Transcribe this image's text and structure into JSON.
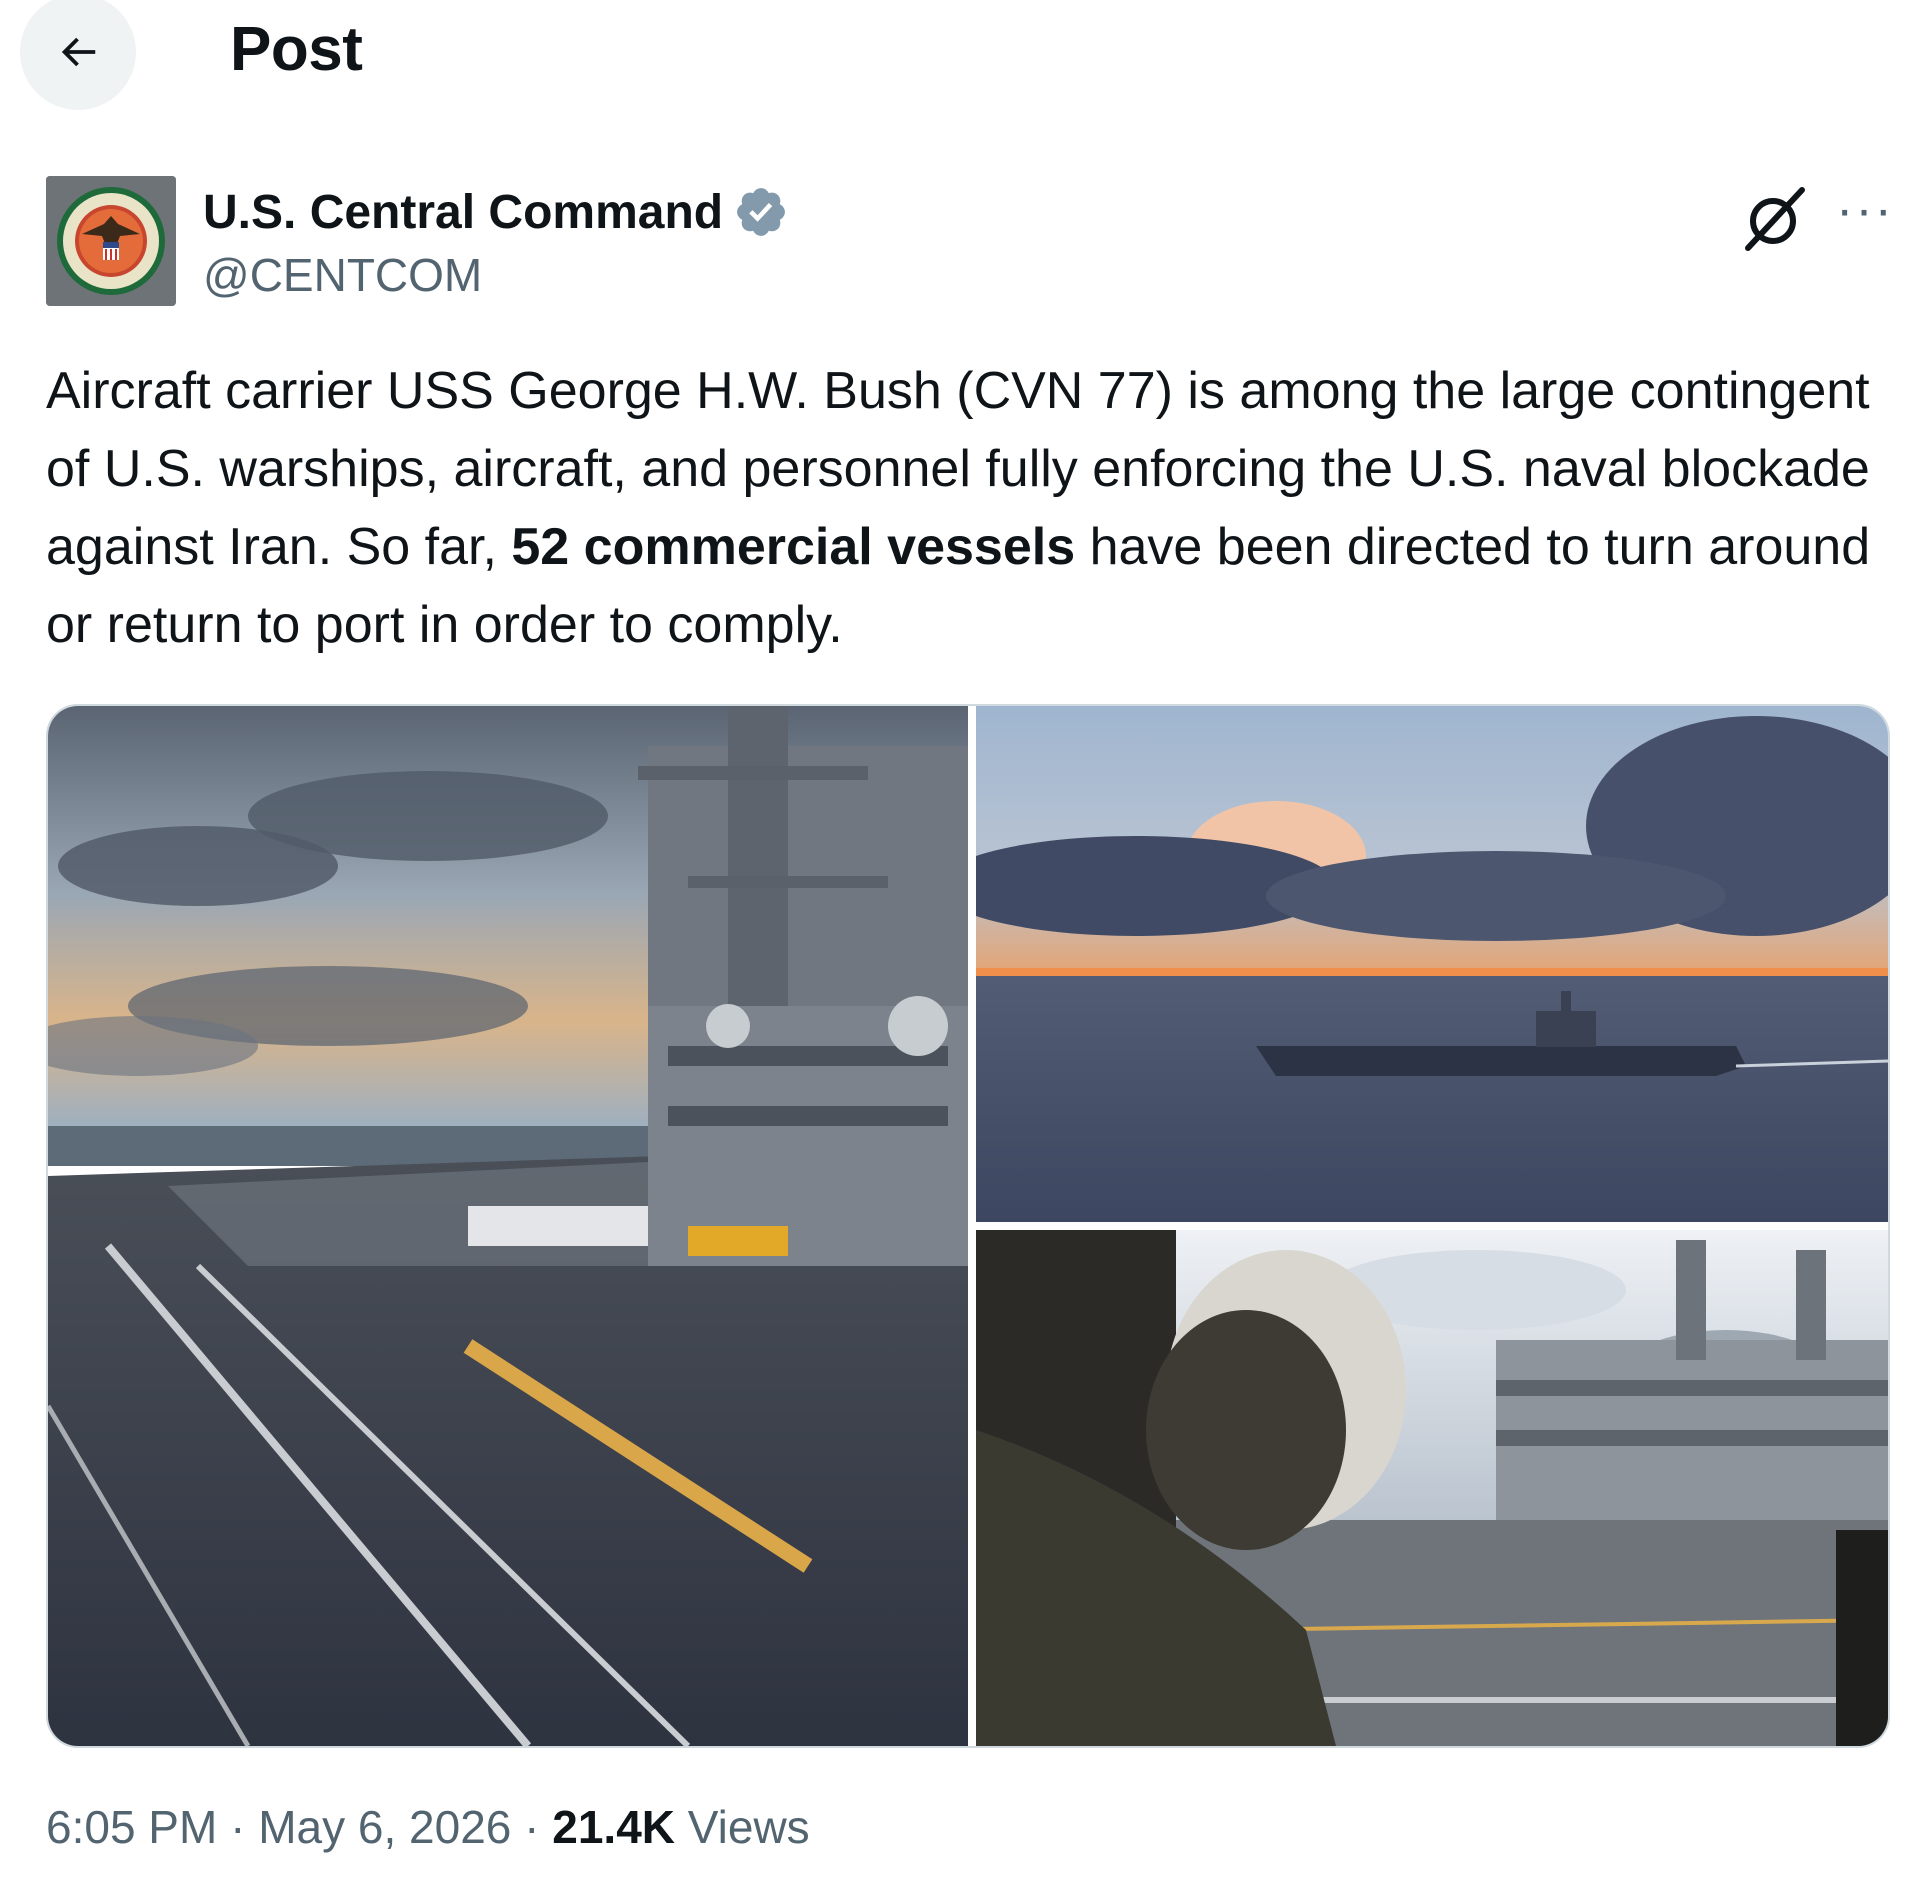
{
  "header": {
    "title": "Post",
    "back_icon": "arrow-left-icon"
  },
  "author": {
    "name": "U.S. Central Command",
    "handle": "@CENTCOM",
    "verified": true,
    "verified_color": "#829aab"
  },
  "actions": {
    "grok_icon": "grok-icon",
    "more_icon": "more-horizontal-icon",
    "more_label": "···"
  },
  "tweet": {
    "text_before": "Aircraft carrier USS George H.W. Bush (CVN 77) is among the large contingent of U.S. warships, aircraft, and personnel fully enforcing the U.S. naval blockade against Iran. So far, ",
    "text_bold": "52 commercial vessels",
    "text_after": " have been directed to turn around or return to port in order to comply."
  },
  "media": {
    "photo_count": 3
  },
  "meta": {
    "time": "6:05 PM",
    "separator": "·",
    "date": "May 6, 2026",
    "views_count": "21.4K",
    "views_label": "Views"
  },
  "colors": {
    "text": "#0f1419",
    "secondary": "#536471",
    "border": "#cfd9de"
  }
}
